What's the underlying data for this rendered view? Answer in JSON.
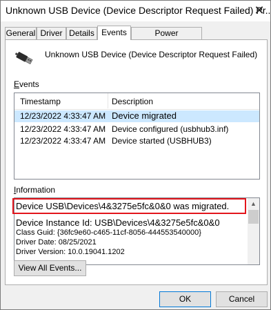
{
  "window": {
    "title": "Unknown USB Device (Device Descriptor Request Failed) Pr...",
    "close_glyph": "✕"
  },
  "tabs": [
    {
      "label": "General"
    },
    {
      "label": "Driver"
    },
    {
      "label": "Details"
    },
    {
      "label": "Events",
      "active": true
    },
    {
      "label": "Power Management"
    }
  ],
  "device": {
    "icon": "usb-plug-icon",
    "name": "Unknown USB Device (Device Descriptor Request Failed)"
  },
  "events": {
    "label": "Events",
    "columns": [
      "Timestamp",
      "Description"
    ],
    "rows": [
      {
        "timestamp": "12/23/2022 4:33:47 AM",
        "description": "Device migrated"
      },
      {
        "timestamp": "12/23/2022 4:33:47 AM",
        "description": "Device configured (usbhub3.inf)"
      },
      {
        "timestamp": "12/23/2022 4:33:47 AM",
        "description": "Device started (USBHUB3)"
      }
    ]
  },
  "information": {
    "label": "Information",
    "lines": [
      "Device USB\\Devices\\4&3275e5fc&0&0 was migrated.",
      "Device Instance Id: USB\\Devices\\4&3275e5fc&0&0",
      "Class Guid: {36fc9e60-c465-11cf-8056-444553540000}",
      "Driver Date: 08/25/2021",
      "Driver Version: 10.0.19041.1202"
    ]
  },
  "buttons": {
    "view_all": "View All Events...",
    "ok": "OK",
    "cancel": "Cancel"
  },
  "colors": {
    "selection": "#cce8ff",
    "annotation": "#e3141b"
  }
}
